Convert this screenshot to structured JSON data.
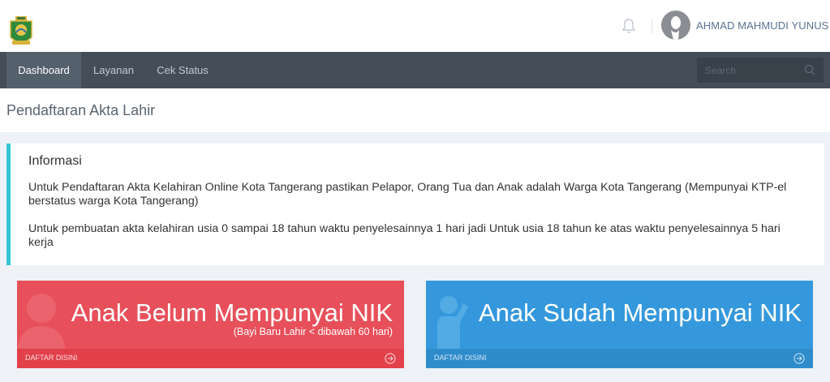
{
  "header": {
    "username": "AHMAD MAHMUDI YUNUS",
    "icons": {
      "logo": "city-emblem-logo",
      "notification": "bell-icon",
      "avatar": "user-silhouette-icon"
    }
  },
  "nav": {
    "items": [
      {
        "label": "Dashboard",
        "active": true
      },
      {
        "label": "Layanan",
        "active": false
      },
      {
        "label": "Cek Status",
        "active": false
      }
    ],
    "search": {
      "placeholder": "Search",
      "value": ""
    }
  },
  "page": {
    "title": "Pendaftaran Akta Lahir"
  },
  "info": {
    "title": "Informasi",
    "paragraph1": "Untuk Pendaftaran Akta Kelahiran Online Kota Tangerang pastikan Pelapor, Orang Tua dan Anak adalah Warga Kota Tangerang (Mempunyai KTP-el berstatus warga Kota Tangerang)",
    "paragraph2": "Untuk pembuatan akta kelahiran usia 0 sampai 18 tahun waktu penyelesainnya 1 hari jadi Untuk usia 18 tahun ke atas waktu penyelesainnya 5 hari kerja"
  },
  "tiles": [
    {
      "title": "Anak Belum Mempunyai NIK",
      "subtitle": "(Bayi Baru Lahir < dibawah 60 hari)",
      "link": "DAFTAR DISINI",
      "color": "#e7505a",
      "icon": "user-icon"
    },
    {
      "title": "Anak Sudah Mempunyai NIK",
      "subtitle": "",
      "link": "DAFTAR DISINI",
      "color": "#3598dc",
      "icon": "child-waving-icon"
    }
  ],
  "colors": {
    "accent": "#36c6d3",
    "navbar": "#444d58",
    "red": "#e7505a",
    "blue": "#3598dc"
  }
}
